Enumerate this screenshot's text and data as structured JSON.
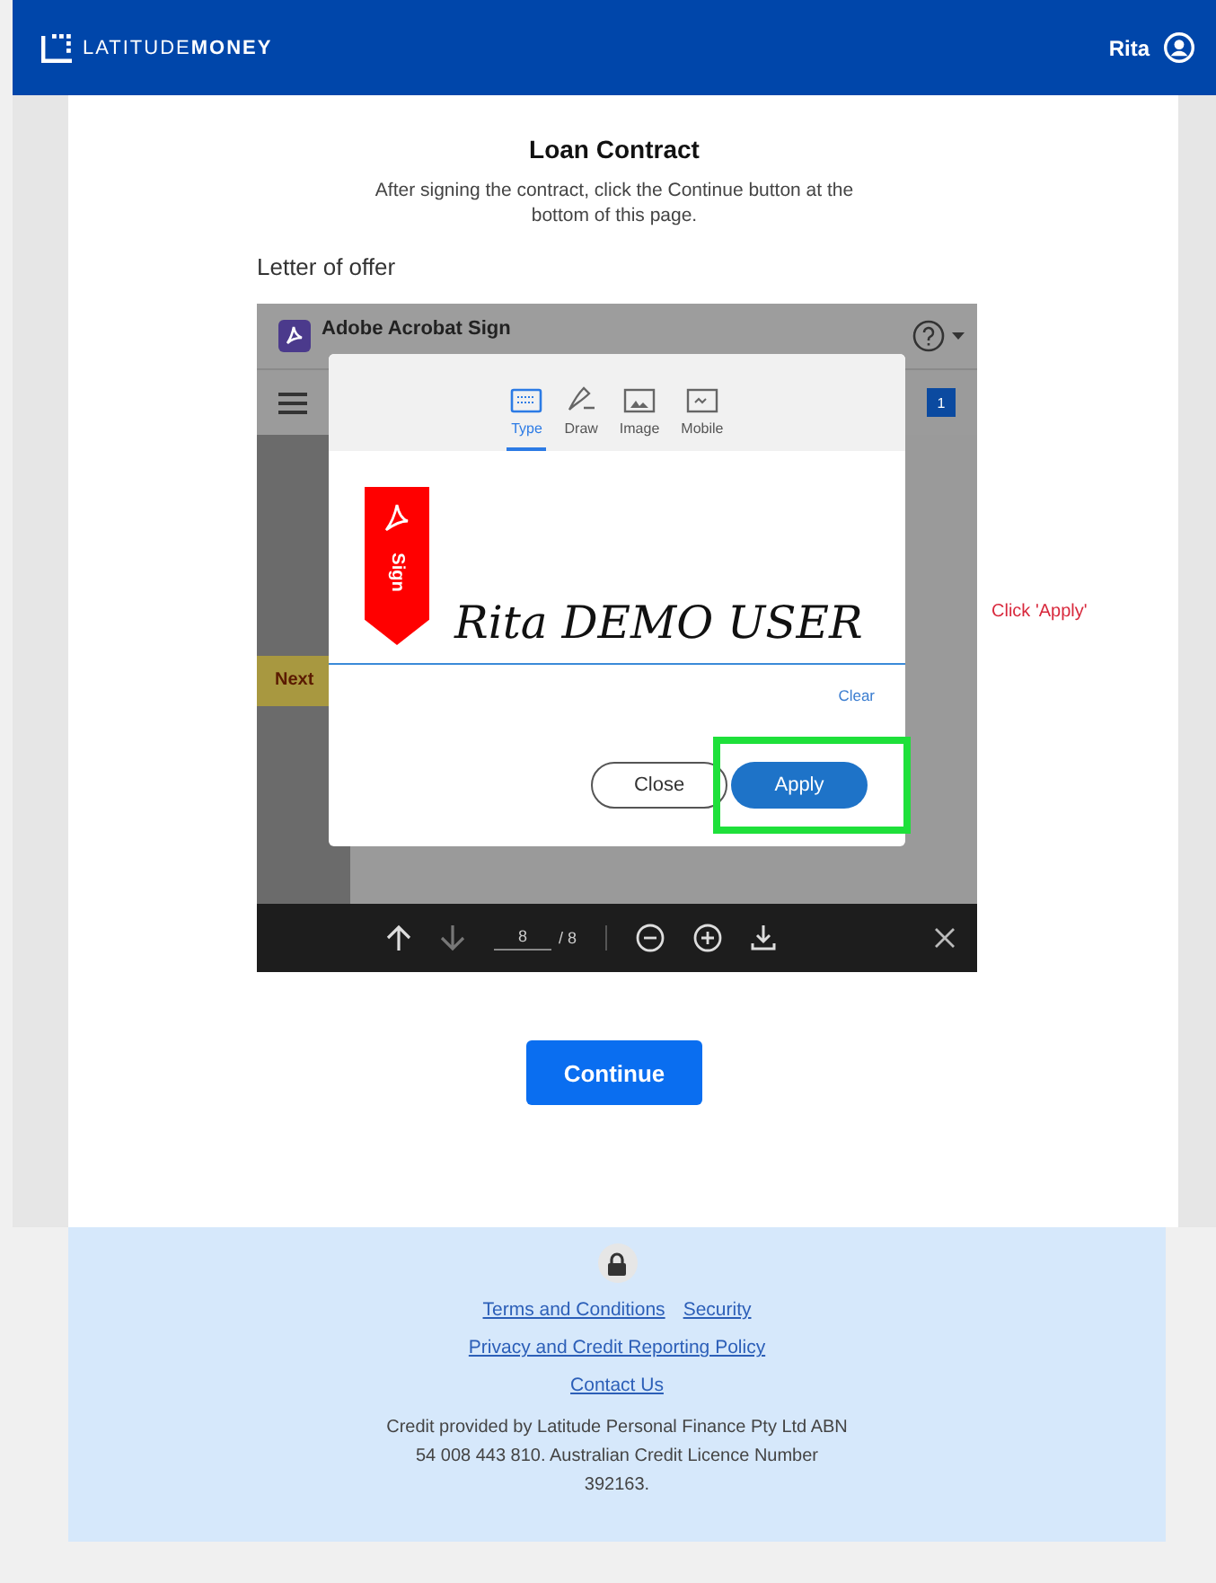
{
  "header": {
    "brand_light": "LATITUDE",
    "brand_bold": "MONEY",
    "user": "Rita"
  },
  "title": "Loan Contract",
  "intro": "After signing the contract, click the Continue button at the bottom of this page.",
  "section_label": "Letter of offer",
  "viewer": {
    "app_title": "Adobe Acrobat Sign",
    "page_badge": "1",
    "next_tag": "Next",
    "modal": {
      "tabs": [
        {
          "label": "Type",
          "selected": true
        },
        {
          "label": "Draw",
          "selected": false
        },
        {
          "label": "Image",
          "selected": false
        },
        {
          "label": "Mobile",
          "selected": false
        }
      ],
      "ribbon_text": "Sign",
      "signature": "Rita DEMO USER",
      "clear": "Clear",
      "buttons": [
        {
          "label": "Close",
          "kind": "outline"
        },
        {
          "label": "Apply",
          "kind": "primary",
          "highlighted": true
        }
      ]
    },
    "toolbar": {
      "page": "8",
      "total": "/ 8"
    }
  },
  "annotation": "Click 'Apply'",
  "continue": "Continue",
  "footer": {
    "link_rows": [
      [
        "Terms and Conditions",
        "Security"
      ],
      [
        "Privacy and Credit Reporting Policy"
      ],
      [
        "Contact Us"
      ]
    ],
    "credit": "Credit provided by Latitude Personal Finance Pty Ltd ABN 54 008 443 810. Australian Credit Licence Number 392163."
  }
}
